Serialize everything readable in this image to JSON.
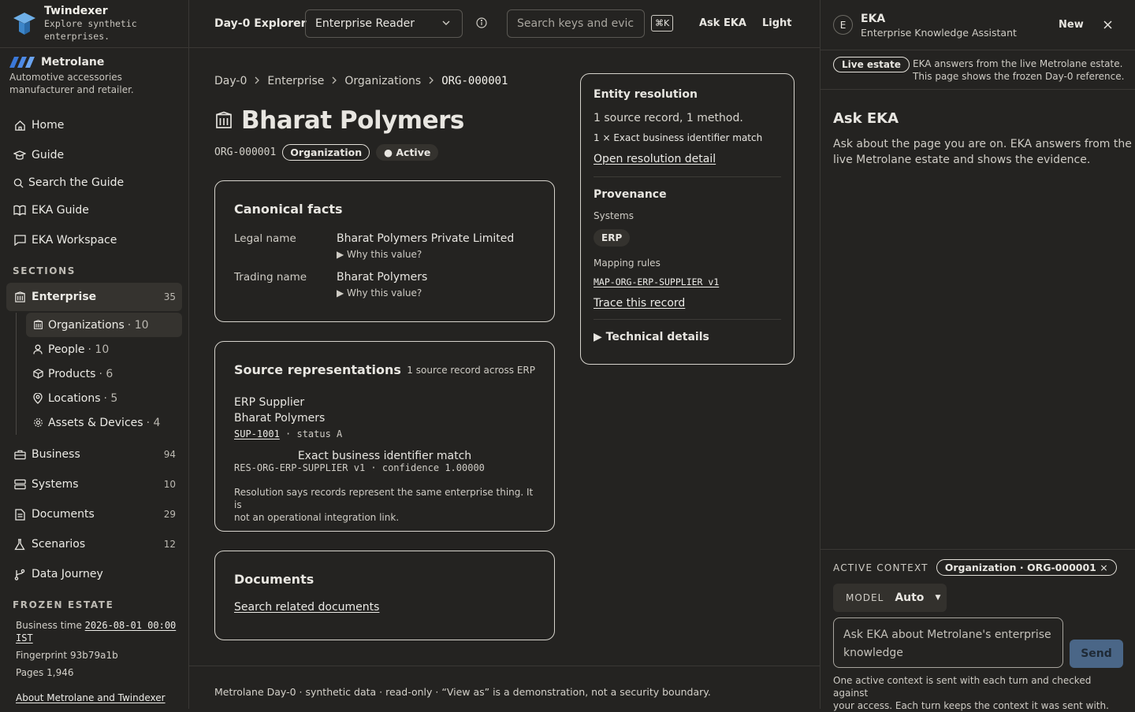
{
  "brand": {
    "name": "Twindexer",
    "tagline_line1": "Explore synthetic",
    "tagline_line2": "enterprises."
  },
  "tenant": {
    "name": "Metrolane",
    "desc_line1": "Automotive accessories",
    "desc_line2": "manufacturer and retailer."
  },
  "nav": {
    "home": "Home",
    "guide": "Guide",
    "search_guide": "Search the Guide",
    "eka_guide": "EKA Guide",
    "eka_workspace": "EKA Workspace",
    "sections_label": "SECTIONS",
    "enterprise": {
      "label": "Enterprise",
      "count": "35"
    },
    "sub": [
      {
        "label": "Organizations",
        "count": "· 10"
      },
      {
        "label": "People",
        "count": "· 10"
      },
      {
        "label": "Products",
        "count": "· 6"
      },
      {
        "label": "Locations",
        "count": "· 5"
      },
      {
        "label": "Assets & Devices",
        "count": "· 4"
      }
    ],
    "business": {
      "label": "Business",
      "count": "94"
    },
    "systems": {
      "label": "Systems",
      "count": "10"
    },
    "documents": {
      "label": "Documents",
      "count": "29"
    },
    "scenarios": {
      "label": "Scenarios",
      "count": "12"
    },
    "data_journey": "Data Journey"
  },
  "frozen": {
    "label": "FROZEN ESTATE",
    "business_time_label": "Business time",
    "business_time_value1": "2026-08-01 00:00",
    "business_time_value2": "IST",
    "fingerprint_label": "Fingerprint",
    "fingerprint_value": "93b79a1b",
    "pages_label": "Pages",
    "pages_value": "1,946",
    "about": "About Metrolane and Twindexer"
  },
  "topbar": {
    "title": "Day-0 Explorer",
    "view_select": "Enterprise Reader",
    "search_placeholder": "Search keys and evic",
    "shortcut": "⌘K",
    "ask_eka": "Ask EKA",
    "theme": "Light"
  },
  "breadcrumb": [
    "Day-0",
    "Enterprise",
    "Organizations",
    "ORG-000001"
  ],
  "entity": {
    "title": "Bharat Polymers",
    "id": "ORG-000001",
    "type": "Organization",
    "status": "Active"
  },
  "facts": {
    "title": "Canonical facts",
    "rows": [
      {
        "key": "Legal name",
        "value": "Bharat Polymers Private Limited",
        "why": "Why this value?"
      },
      {
        "key": "Trading name",
        "value": "Bharat Polymers",
        "why": "Why this value?"
      }
    ]
  },
  "sources": {
    "title": "Source representations",
    "note": "1 source record across ERP",
    "rec_type": "ERP Supplier",
    "rec_name": "Bharat Polymers",
    "rec_id": "SUP-1001",
    "rec_status": "· status A",
    "match_title": "Exact business identifier match",
    "match_rule": "RES-ORG-ERP-SUPPLIER v1",
    "match_conf": "· confidence 1.00000",
    "para_line1": "Resolution says records represent the same enterprise thing. It is",
    "para_line2": "not an operational integration link."
  },
  "documents": {
    "title": "Documents",
    "link": "Search related documents"
  },
  "resolution": {
    "title": "Entity resolution",
    "summary": "1 source record, 1 method.",
    "method": "1 × Exact business identifier match",
    "link": "Open resolution detail"
  },
  "provenance": {
    "title": "Provenance",
    "systems_label": "Systems",
    "system": "ERP",
    "rules_label": "Mapping rules",
    "rule": "MAP-ORG-ERP-SUPPLIER_v1",
    "trace": "Trace this record",
    "tech": "Technical details"
  },
  "footer": "Metrolane Day-0 · synthetic data · read-only · “View as” is a demonstration, not a security boundary.",
  "eka": {
    "avatar": "E",
    "title": "EKA",
    "subtitle": "Enterprise Knowledge Assistant",
    "new": "New",
    "live_pill": "Live estate",
    "live_line1": "EKA answers from the live Metrolane estate.",
    "live_line2": "This page shows the frozen Day-0 reference.",
    "ask_title": "Ask EKA",
    "ask_line1": "Ask about the page you are on. EKA answers from the",
    "ask_line2": "live Metrolane estate and shows the evidence.",
    "ctx_label": "ACTIVE CONTEXT",
    "ctx_pill": "Organization · ORG-000001",
    "model_label": "MODEL",
    "model_value": "Auto",
    "prompt_placeholder": "Ask EKA about Metrolane's enterprise knowledge",
    "send": "Send",
    "foot_line1": "One active context is sent with each turn and checked against",
    "foot_line2": "your access. Each turn keeps the context it was sent with."
  }
}
